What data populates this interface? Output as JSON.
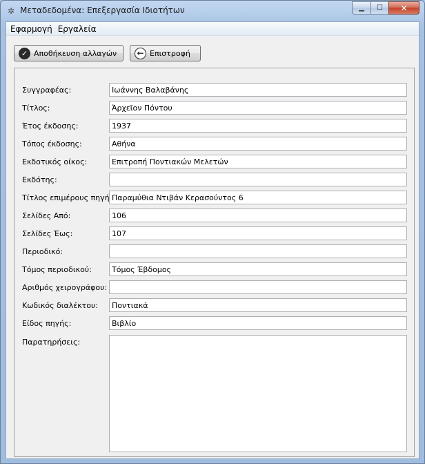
{
  "window": {
    "title": "Μεταδεδομένα: Επεξεργασία Ιδιοτήτων",
    "minimize_glyph": "▁",
    "maximize_glyph": "☐",
    "close_glyph": "✕"
  },
  "menu": {
    "items": [
      {
        "label": "Εφαρμογή"
      },
      {
        "label": "Εργαλεία"
      }
    ]
  },
  "toolbar": {
    "save_label": "Αποθήκευση αλλαγών",
    "save_icon": "check-circle-icon",
    "back_label": "Επιστροφή",
    "back_icon": "arrow-left-circle-icon"
  },
  "form": {
    "fields": [
      {
        "label": "Συγγραφέας:",
        "value": "Ιωάννης Βαλαβάνης"
      },
      {
        "label": "Τίτλος:",
        "value": "Ἀρχεῖον Πόντου"
      },
      {
        "label": "Έτος έκδοσης:",
        "value": "1937"
      },
      {
        "label": "Τόπος έκδοσης:",
        "value": "Αθήνα"
      },
      {
        "label": "Εκδοτικός οίκος:",
        "value": "Επιτροπή Ποντιακών Μελετών"
      },
      {
        "label": "Εκδότης:",
        "value": ""
      },
      {
        "label": "Τίτλος επιμέρους πηγής:",
        "value": "Παραμύθια Ντιβάν Κερασούντος 6"
      },
      {
        "label": "Σελίδες Από:",
        "value": "106"
      },
      {
        "label": "Σελίδες Έως:",
        "value": "107"
      },
      {
        "label": "Περιοδικό:",
        "value": ""
      },
      {
        "label": "Τόμος περιοδικού:",
        "value": "Τόμος Έβδομος"
      },
      {
        "label": "Αριθμός χειρογράφου:",
        "value": ""
      },
      {
        "label": "Κωδικός διαλέκτου:",
        "value": "Ποντιακά"
      },
      {
        "label": "Είδος πηγής:",
        "value": "Βιβλίο"
      }
    ],
    "notes_label": "Παρατηρήσεις:",
    "notes_value": ""
  }
}
